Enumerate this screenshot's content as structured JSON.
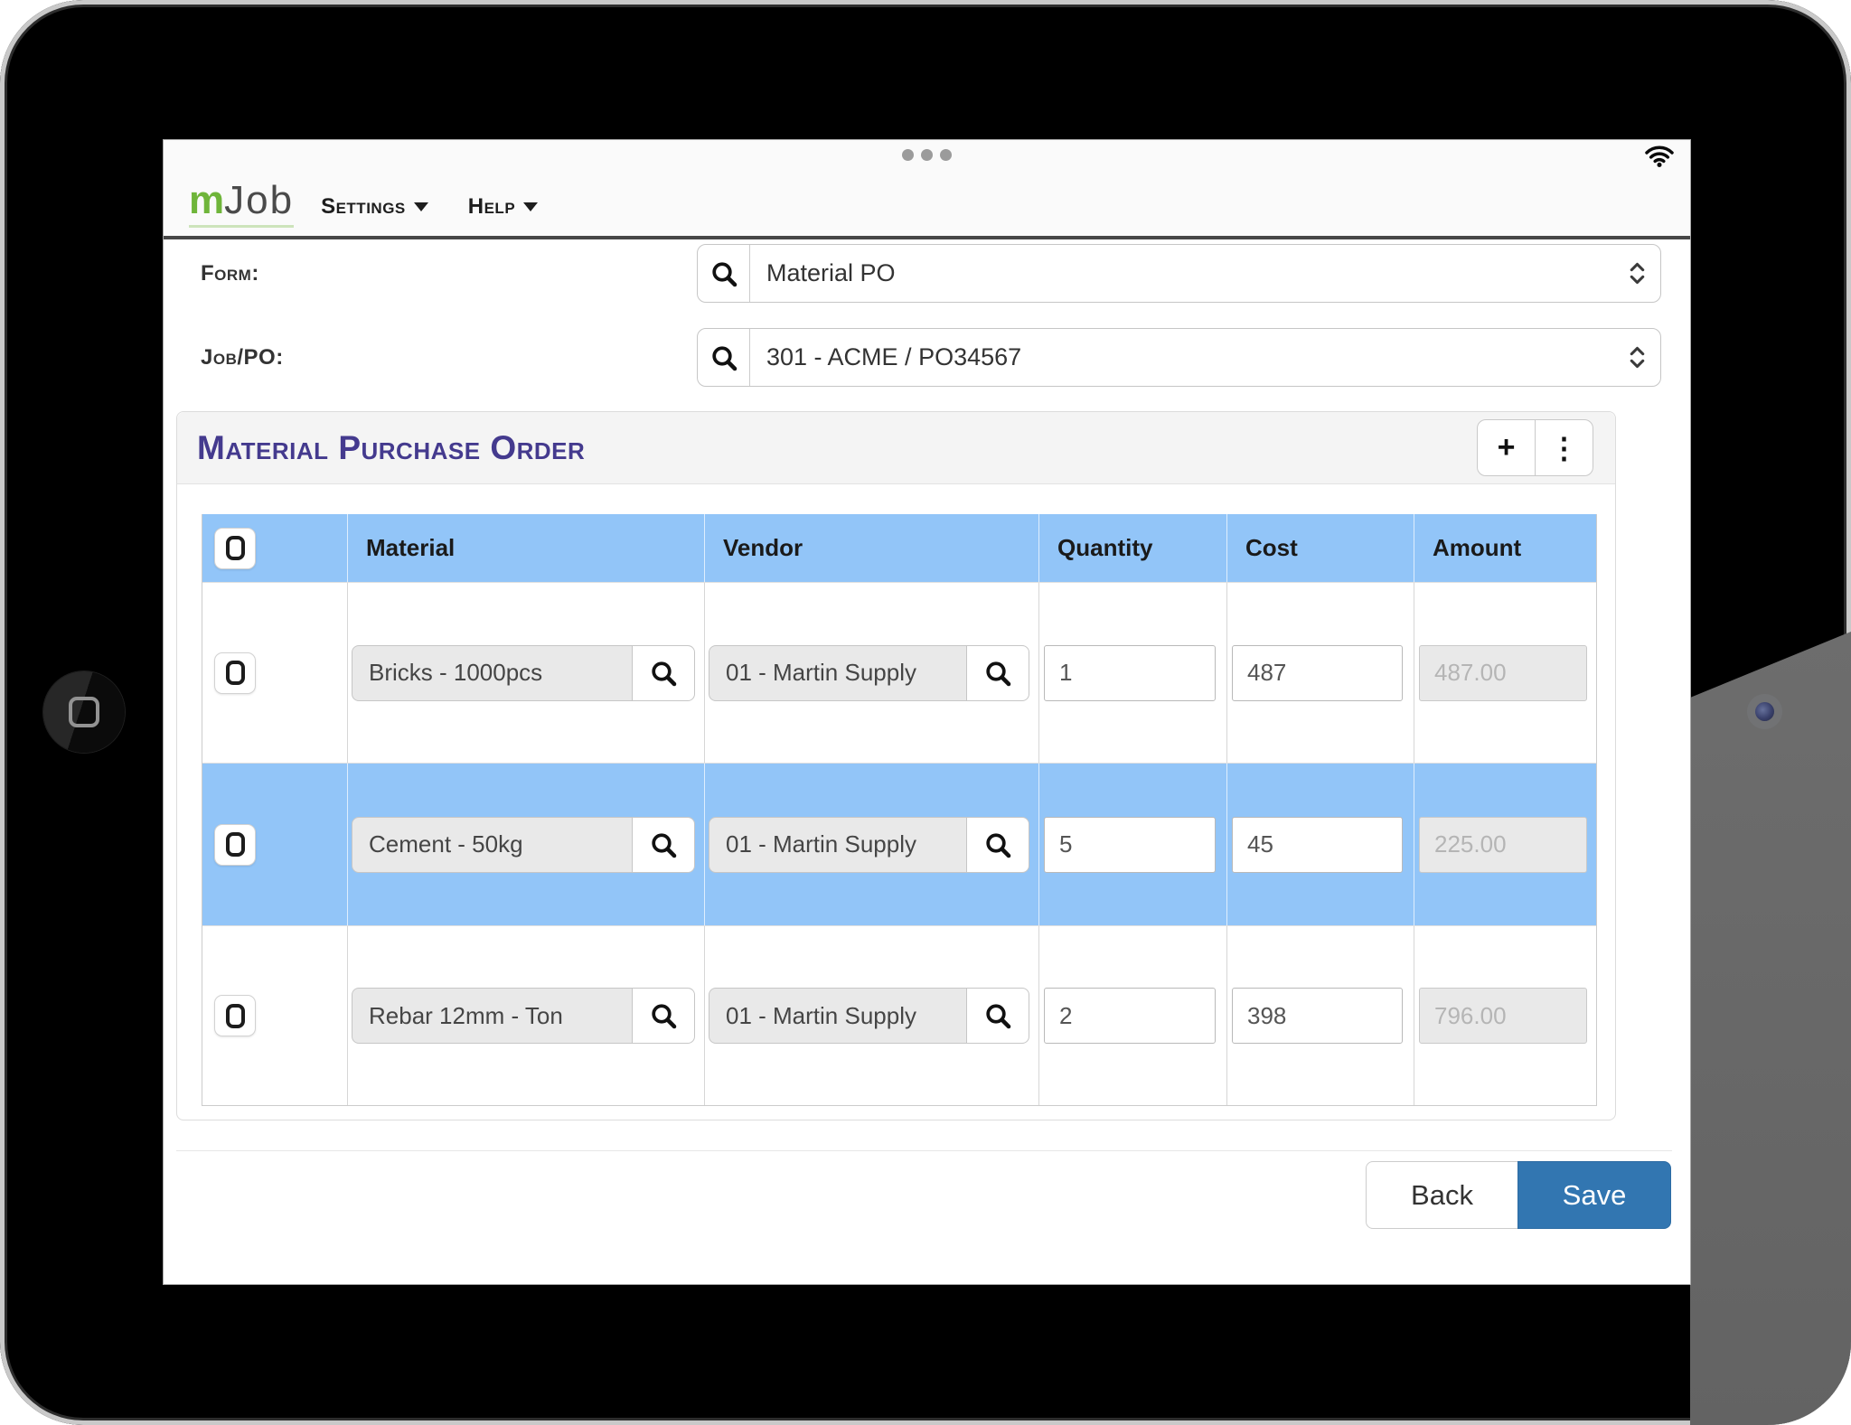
{
  "header": {
    "logo_m": "m",
    "logo_rest": "Job",
    "menus": [
      {
        "label": "Settings"
      },
      {
        "label": "Help"
      }
    ]
  },
  "form_fields": {
    "form_label": "Form:",
    "form_value": "Material PO",
    "job_label": "Job/PO:",
    "job_value": "301 - ACME / PO34567"
  },
  "panel": {
    "title": "Material Purchase Order"
  },
  "table": {
    "headers": {
      "material": "Material",
      "vendor": "Vendor",
      "quantity": "Quantity",
      "cost": "Cost",
      "amount": "Amount"
    },
    "rows": [
      {
        "material": "Bricks - 1000pcs",
        "vendor": "01 - Martin Supply",
        "quantity": "1",
        "cost": "487",
        "amount": "487.00",
        "selected": false
      },
      {
        "material": "Cement - 50kg",
        "vendor": "01 - Martin Supply",
        "quantity": "5",
        "cost": "45",
        "amount": "225.00",
        "selected": true
      },
      {
        "material": "Rebar 12mm - Ton",
        "vendor": "01 - Martin Supply",
        "quantity": "2",
        "cost": "398",
        "amount": "796.00",
        "selected": false
      }
    ]
  },
  "actions": {
    "back_label": "Back",
    "save_label": "Save"
  },
  "icons": {
    "plus_glyph": "+",
    "more_glyph": "⋮",
    "search": "magnifier",
    "select_stepper": "chevron-up-down",
    "wifi": "wifi-signal",
    "row_checkbox": "rounded-square-checkbox"
  },
  "colors": {
    "selection_blue": "#92c5f8",
    "save_blue": "#3276b1",
    "title_purple": "#443a8e",
    "logo_green": "#6fb53a",
    "header_border": "#474747"
  }
}
